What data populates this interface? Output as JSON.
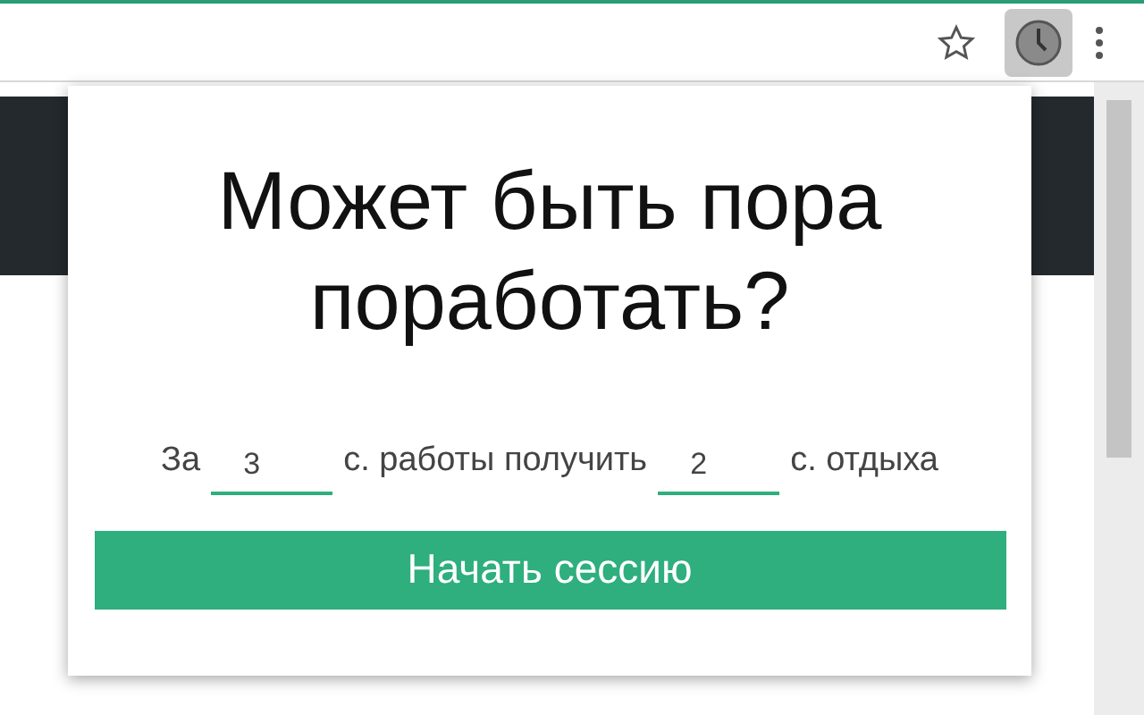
{
  "popup": {
    "title": "Может быть пора поработать?",
    "sentence": [
      {
        "kind": "text",
        "text": "За"
      },
      {
        "kind": "input",
        "value": "3"
      },
      {
        "kind": "text",
        "text": "с. работы получить"
      },
      {
        "kind": "input",
        "value": "2"
      },
      {
        "kind": "text",
        "text": "с. отдыха"
      }
    ],
    "button": "Начать сессию"
  }
}
